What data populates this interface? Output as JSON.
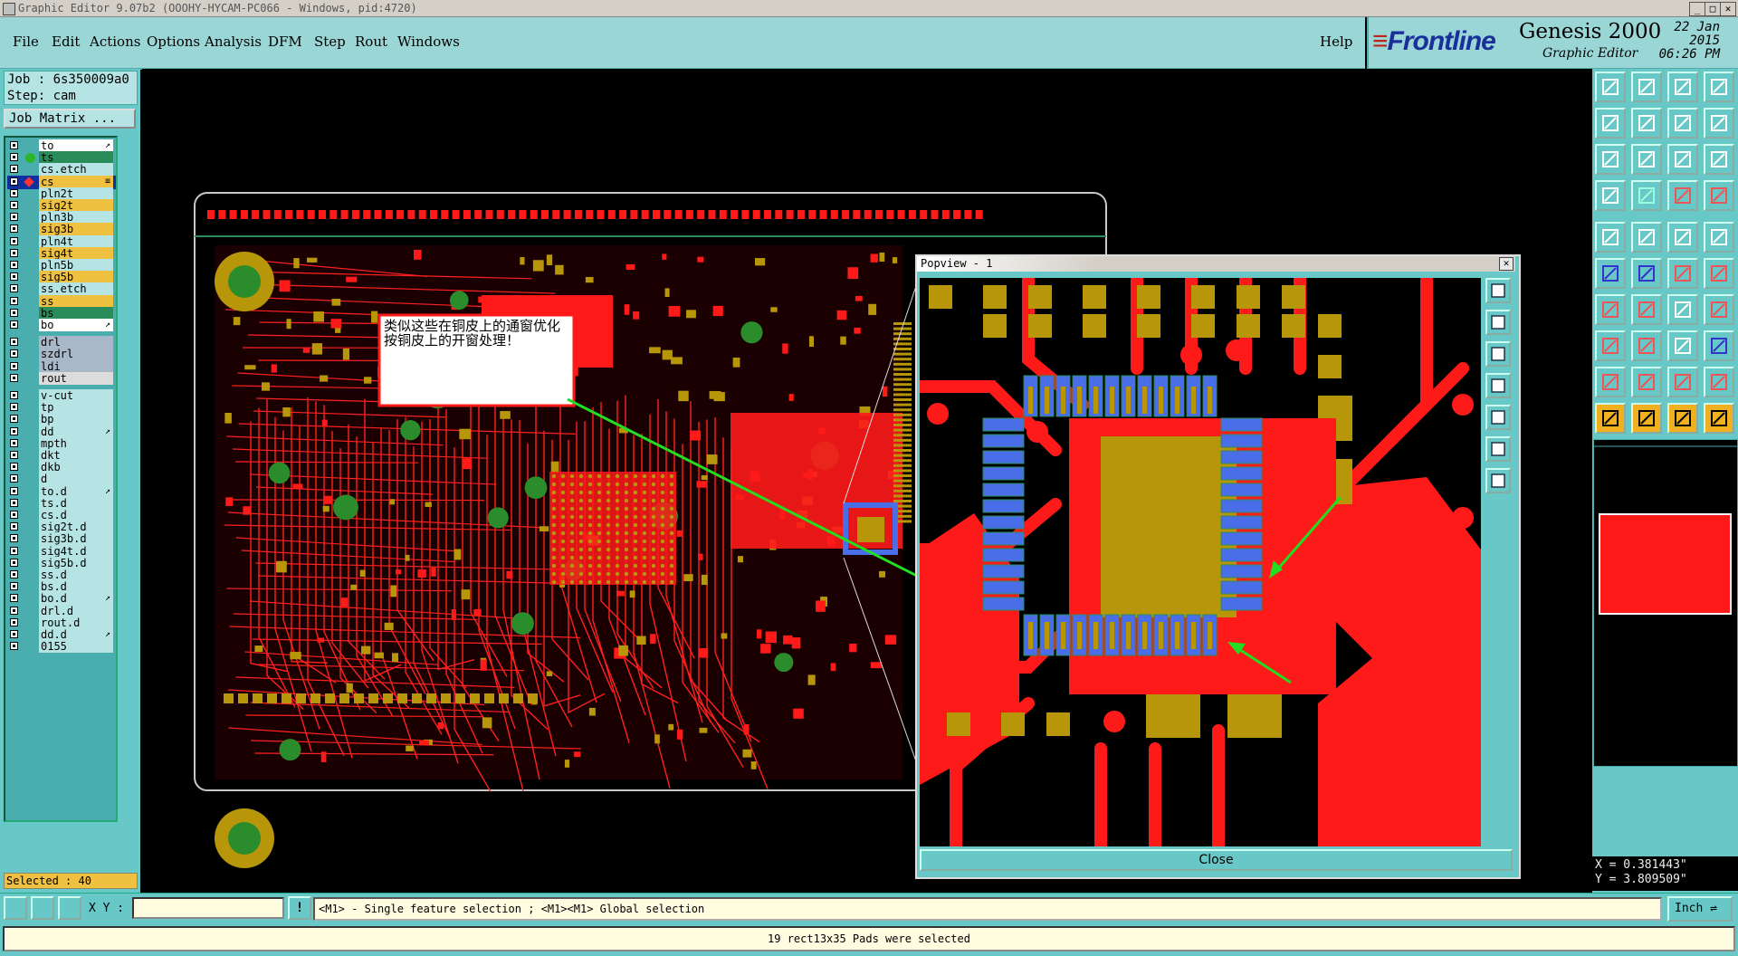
{
  "window": {
    "title": "Graphic Editor 9.07b2 (OOOHY-HYCAM-PC066 - Windows, pid:4720)"
  },
  "menu": {
    "items": [
      "File",
      "Edit",
      "Actions",
      "Options",
      "Analysis",
      "DFM",
      "Step",
      "Rout",
      "Windows"
    ],
    "help": "Help"
  },
  "brand": {
    "logo": "Frontline",
    "product": "Genesis 2000",
    "subtitle": "Graphic Editor",
    "date": "22 Jan 2015",
    "time": "06:26 PM"
  },
  "job": {
    "job": "Job : 6s350009a0",
    "step": "Step: cam",
    "matrix_button": "Job Matrix ..."
  },
  "layers": [
    {
      "name": "to",
      "color": "#ffffff",
      "flag": "↗"
    },
    {
      "name": "ts",
      "color": "#2a8c5a",
      "flag": ""
    },
    {
      "name": "cs.etch",
      "color": "#b6e4e4",
      "flag": ""
    },
    {
      "name": "cs",
      "color": "#f0c040",
      "flag": "≡",
      "active": true
    },
    {
      "name": "pln2t",
      "color": "#b6e4e4",
      "flag": ""
    },
    {
      "name": "sig2t",
      "color": "#f0c040",
      "flag": ""
    },
    {
      "name": "pln3b",
      "color": "#b6e4e4",
      "flag": ""
    },
    {
      "name": "sig3b",
      "color": "#f0c040",
      "flag": ""
    },
    {
      "name": "pln4t",
      "color": "#b6e4e4",
      "flag": ""
    },
    {
      "name": "sig4t",
      "color": "#f0c040",
      "flag": ""
    },
    {
      "name": "pln5b",
      "color": "#b6e4e4",
      "flag": ""
    },
    {
      "name": "sig5b",
      "color": "#f0c040",
      "flag": ""
    },
    {
      "name": "ss.etch",
      "color": "#b6e4e4",
      "flag": ""
    },
    {
      "name": "ss",
      "color": "#f0c040",
      "flag": ""
    },
    {
      "name": "bs",
      "color": "#2a8c5a",
      "flag": ""
    },
    {
      "name": "bo",
      "color": "#ffffff",
      "flag": "↗"
    },
    {
      "name": "drl",
      "color": "#a8b8c8",
      "flag": ""
    },
    {
      "name": "szdrl",
      "color": "#a8b8c8",
      "flag": ""
    },
    {
      "name": "ldi",
      "color": "#a8b8c8",
      "flag": ""
    },
    {
      "name": "rout",
      "color": "#dcdcdc",
      "flag": ""
    },
    {
      "name": "v-cut",
      "color": "#b6e4e4",
      "flag": ""
    },
    {
      "name": "tp",
      "color": "#b6e4e4",
      "flag": ""
    },
    {
      "name": "bp",
      "color": "#b6e4e4",
      "flag": ""
    },
    {
      "name": "dd",
      "color": "#b6e4e4",
      "flag": "↗"
    },
    {
      "name": "mpth",
      "color": "#b6e4e4",
      "flag": ""
    },
    {
      "name": "dkt",
      "color": "#b6e4e4",
      "flag": ""
    },
    {
      "name": "dkb",
      "color": "#b6e4e4",
      "flag": ""
    },
    {
      "name": "d",
      "color": "#b6e4e4",
      "flag": ""
    },
    {
      "name": "to.d",
      "color": "#b6e4e4",
      "flag": "↗"
    },
    {
      "name": "ts.d",
      "color": "#b6e4e4",
      "flag": ""
    },
    {
      "name": "cs.d",
      "color": "#b6e4e4",
      "flag": ""
    },
    {
      "name": "sig2t.d",
      "color": "#b6e4e4",
      "flag": ""
    },
    {
      "name": "sig3b.d",
      "color": "#b6e4e4",
      "flag": ""
    },
    {
      "name": "sig4t.d",
      "color": "#b6e4e4",
      "flag": ""
    },
    {
      "name": "sig5b.d",
      "color": "#b6e4e4",
      "flag": ""
    },
    {
      "name": "ss.d",
      "color": "#b6e4e4",
      "flag": ""
    },
    {
      "name": "bs.d",
      "color": "#b6e4e4",
      "flag": ""
    },
    {
      "name": "bo.d",
      "color": "#b6e4e4",
      "flag": "↗"
    },
    {
      "name": "drl.d",
      "color": "#b6e4e4",
      "flag": ""
    },
    {
      "name": "rout.d",
      "color": "#b6e4e4",
      "flag": ""
    },
    {
      "name": "dd.d",
      "color": "#b6e4e4",
      "flag": "↗"
    },
    {
      "name": "0155",
      "color": "#b6e4e4",
      "flag": ""
    }
  ],
  "selected": "Selected : 40",
  "annotation": "类似这些在铜皮上的通窗优化按铜皮上的开窗处理！",
  "popview": {
    "title": "Popview - 1",
    "close_label": "Close"
  },
  "coords": {
    "x": "X = 0.381443\"",
    "y": "Y = 3.809509\""
  },
  "command": {
    "xy_label": "X Y :",
    "hint": "<M1> - Single feature selection ; <M1><M1> Global selection",
    "unit": "Inch"
  },
  "status": "19 rect13x35 Pads were selected",
  "colors": {
    "panel": "#68c8c8",
    "copper": "#ff1a1a",
    "pad": "#b8960a",
    "soldermask": "#4a6ee8",
    "trace": "#ff2020"
  }
}
